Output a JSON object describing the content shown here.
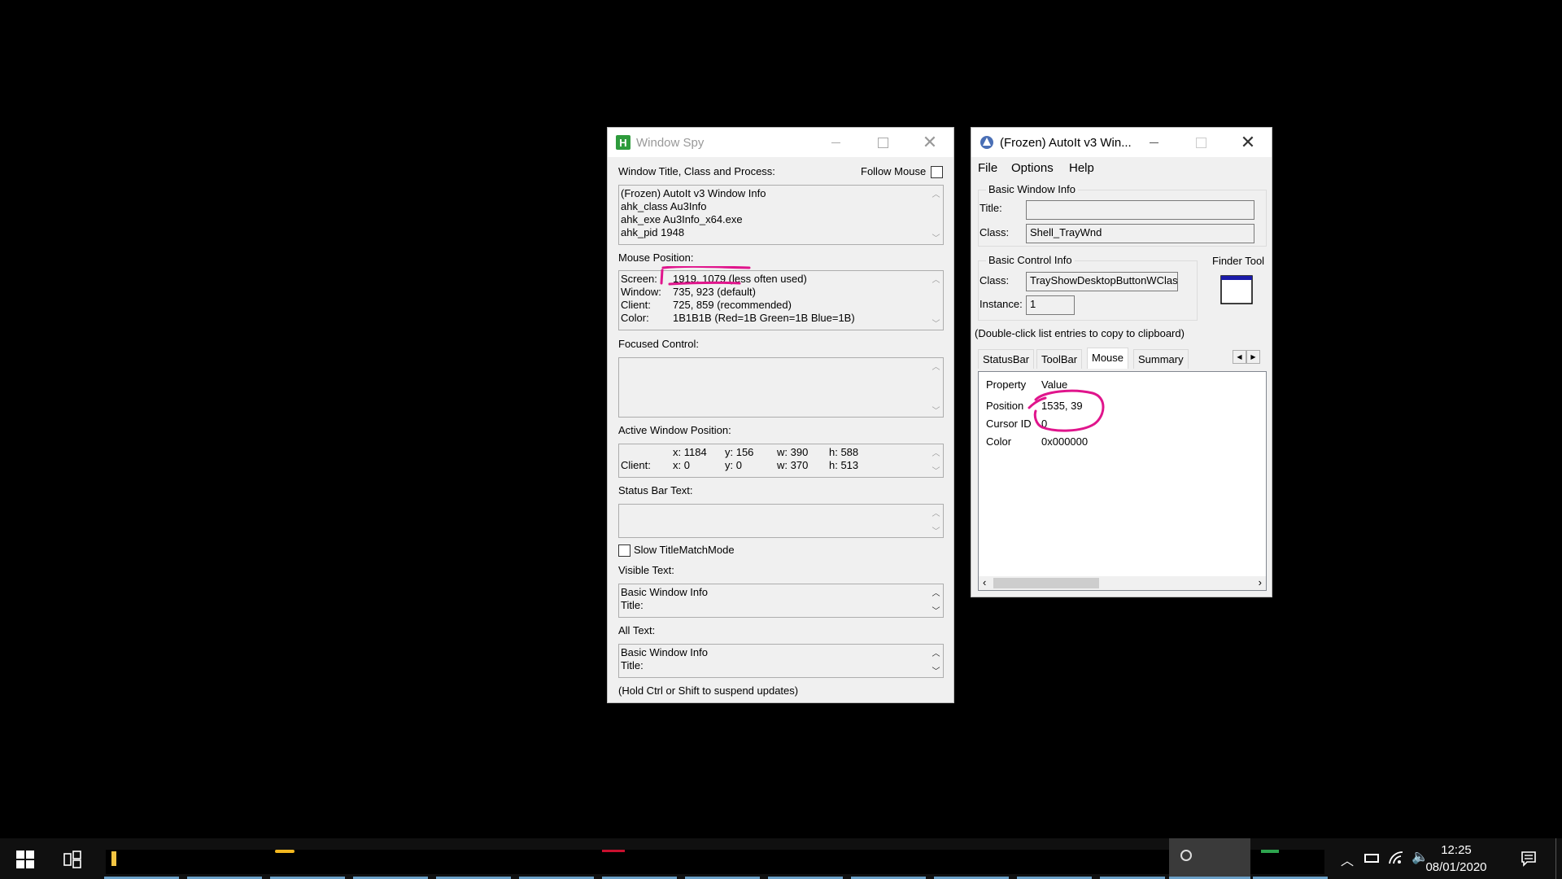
{
  "window_spy": {
    "title": "Window Spy",
    "window_title_label": "Window Title, Class and Process:",
    "follow_mouse_label": "Follow Mouse",
    "title_lines": [
      "(Frozen) AutoIt v3 Window Info",
      "ahk_class Au3Info",
      "ahk_exe Au3Info_x64.exe",
      "ahk_pid 1948"
    ],
    "mouse_position_label": "Mouse Position:",
    "mouse_rows": [
      {
        "key": "Screen:",
        "value": "1919, 1079 (less often used)"
      },
      {
        "key": "Window:",
        "value": "735, 923 (default)"
      },
      {
        "key": "Client:",
        "value": "725, 859 (recommended)"
      },
      {
        "key": "Color:",
        "value": "1B1B1B (Red=1B Green=1B Blue=1B)"
      }
    ],
    "focused_control_label": "Focused Control:",
    "active_window_label": "Active Window Position:",
    "active_rows": [
      {
        "key": "",
        "x": "x: 1184",
        "y": "y: 156",
        "w": "w: 390",
        "h": "h: 588"
      },
      {
        "key": "Client:",
        "x": "x: 0",
        "y": "y: 0",
        "w": "w: 370",
        "h": "h: 513"
      }
    ],
    "status_bar_label": "Status Bar Text:",
    "slow_title_label": "Slow TitleMatchMode",
    "visible_text_label": "Visible Text:",
    "visible_text_lines": [
      "Basic Window Info",
      "Title:"
    ],
    "all_text_label": "All Text:",
    "all_text_lines": [
      "Basic Window Info",
      "Title:"
    ],
    "footer": "(Hold Ctrl or Shift to suspend updates)"
  },
  "autoit": {
    "title": "(Frozen) AutoIt v3 Win...",
    "menu": [
      "File",
      "Options",
      "Help"
    ],
    "basic_window_info": {
      "group_title": "Basic Window Info",
      "title_label": "Title:",
      "title_value": "",
      "class_label": "Class:",
      "class_value": "Shell_TrayWnd"
    },
    "basic_control_info": {
      "group_title": "Basic Control Info",
      "class_label": "Class:",
      "class_value": "TrayShowDesktopButtonWClass",
      "instance_label": "Instance:",
      "instance_value": "1"
    },
    "finder_tool_label": "Finder Tool",
    "hint": "(Double-click list entries to copy to clipboard)",
    "tabs": [
      "StatusBar",
      "ToolBar",
      "Mouse",
      "Summary"
    ],
    "active_tab": "Mouse",
    "columns": [
      "Property",
      "Value"
    ],
    "rows": [
      {
        "property": "Position",
        "value": "1535, 39"
      },
      {
        "property": "Cursor ID",
        "value": "0"
      },
      {
        "property": "Color",
        "value": "0x000000"
      }
    ]
  },
  "taskbar": {
    "time": "12:25",
    "date": "08/01/2020"
  },
  "colors": {
    "annotation": "#e0158c",
    "window_spy_icon": "#2e9b3c",
    "autoit_icon": "#4a6fb5",
    "desktop": "#000000"
  }
}
